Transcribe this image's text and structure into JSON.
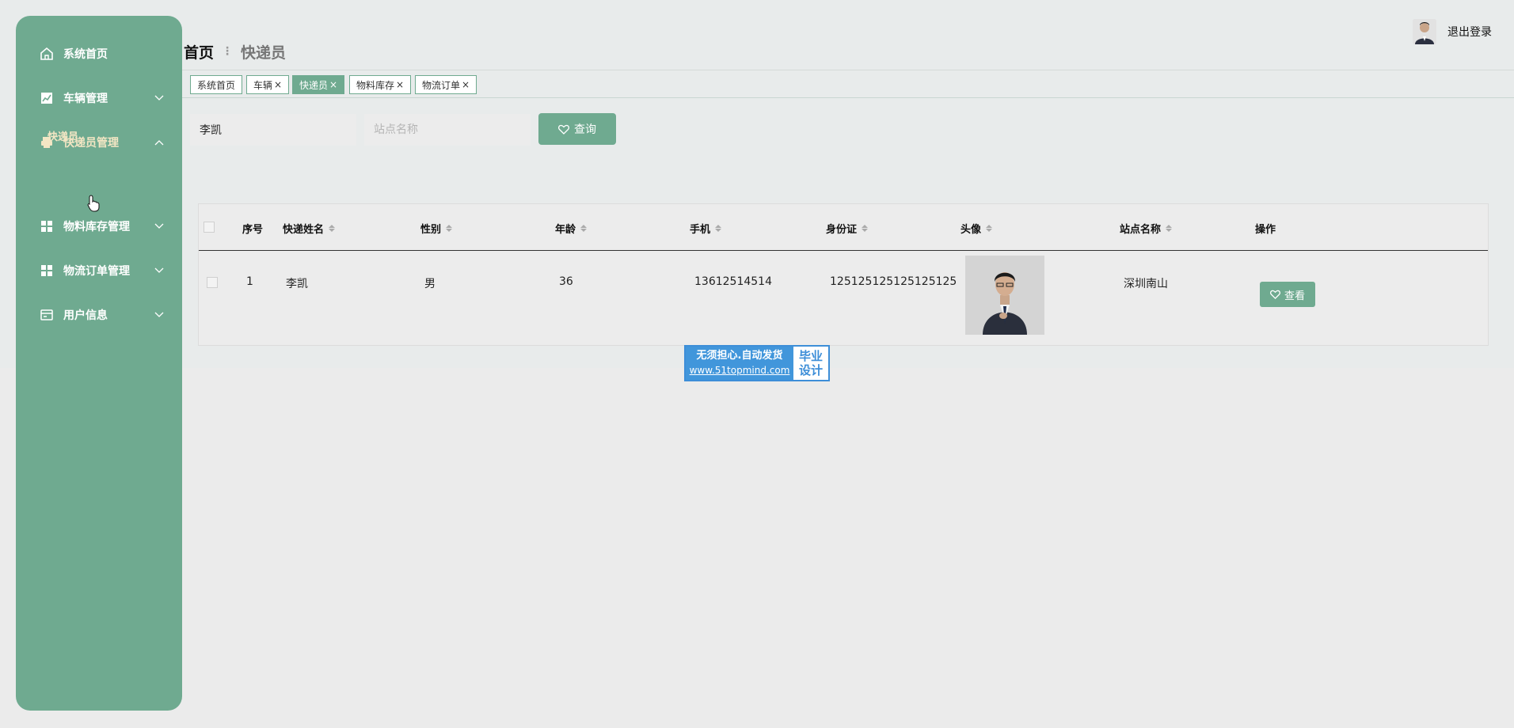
{
  "sidebar": {
    "items": [
      {
        "label": "系统首页",
        "icon": "home-icon"
      },
      {
        "label": "车辆管理",
        "icon": "chart-icon"
      },
      {
        "label": "快递员管理",
        "icon": "printer-icon"
      },
      {
        "label": "物料库存管理",
        "icon": "grid-icon"
      },
      {
        "label": "物流订单管理",
        "icon": "grid-icon"
      },
      {
        "label": "用户信息",
        "icon": "card-icon"
      }
    ],
    "sub_item": "快递员"
  },
  "header": {
    "breadcrumb_home": "首页",
    "breadcrumb_current": "快递员",
    "logout": "退出登录"
  },
  "tabs": [
    {
      "label": "系统首页",
      "closable": false
    },
    {
      "label": "车辆",
      "closable": true
    },
    {
      "label": "快递员",
      "closable": true,
      "active": true
    },
    {
      "label": "物料库存",
      "closable": true
    },
    {
      "label": "物流订单",
      "closable": true
    }
  ],
  "search": {
    "name_value": "李凯",
    "station_placeholder": "站点名称",
    "button": "查询"
  },
  "table": {
    "columns": [
      "序号",
      "快递姓名",
      "性别",
      "年龄",
      "手机",
      "身份证",
      "头像",
      "站点名称",
      "操作"
    ],
    "rows": [
      {
        "index": "1",
        "name": "李凯",
        "gender": "男",
        "age": "36",
        "phone": "13612514514",
        "id_card": "125125125125125125",
        "station": "深圳南山",
        "action": "查看"
      }
    ]
  },
  "watermark": {
    "line1": "无须担心.自动发货",
    "url": "www.51topmind.com",
    "right1": "毕业",
    "right2": "设计"
  },
  "colors": {
    "accent": "#6faa90",
    "badge_blue": "#4196db"
  }
}
